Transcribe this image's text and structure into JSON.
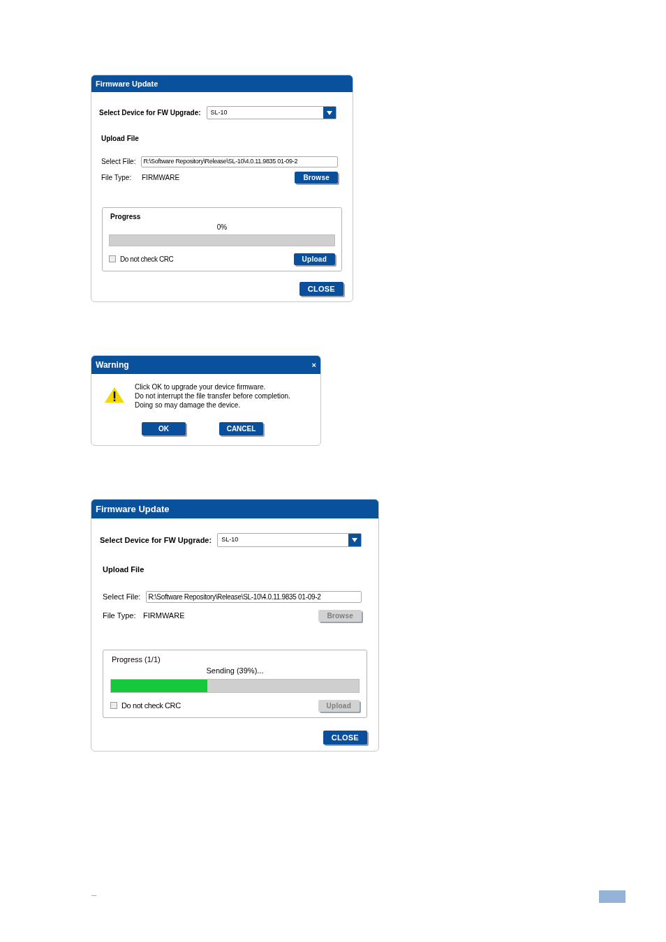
{
  "dialogs": [
    {
      "kind": "firmware",
      "title": "Firmware Update",
      "device_label": "Select Device for FW Upgrade:",
      "device_value": "SL-10",
      "section_title": "Upload File",
      "file_label": "Select File:",
      "file_value": "R:\\Software Repository\\Release\\SL-10\\4.0.11.9835 01-09-2",
      "type_label": "File Type:",
      "type_value": "FIRMWARE",
      "browse_button": {
        "label": "Browse",
        "disabled": false
      },
      "progress": {
        "title": "Progress",
        "status": "0%",
        "level": 0
      },
      "crc_checkbox": {
        "label": "Do not check CRC",
        "checked": false
      },
      "upload_button": {
        "label": "Upload",
        "disabled": false
      },
      "close_button": "CLOSE"
    },
    {
      "kind": "warning",
      "title": "Warning",
      "close": "×",
      "message_lines": [
        "Click OK to upgrade your device firmware.",
        "Do not interrupt the file transfer before completion.",
        "Doing so may damage the device."
      ],
      "buttons": [
        "OK",
        "CANCEL"
      ]
    },
    {
      "kind": "firmware",
      "title": "Firmware Update",
      "device_label": "Select Device for FW Upgrade:",
      "device_value": "SL-10",
      "section_title": "Upload File",
      "file_label": "Select File:",
      "file_value": "R:\\Software Repository\\Release\\SL-10\\4.0.11.9835 01-09-2",
      "type_label": "File Type:",
      "type_value": "FIRMWARE",
      "browse_button": {
        "label": "Browse",
        "disabled": true
      },
      "progress": {
        "title": "Progress (1/1)",
        "status": "Sending (39%)...",
        "level": 0.39
      },
      "crc_checkbox": {
        "label": "Do not check CRC",
        "checked": false
      },
      "upload_button": {
        "label": "Upload",
        "disabled": true
      },
      "close_button": "CLOSE"
    }
  ]
}
